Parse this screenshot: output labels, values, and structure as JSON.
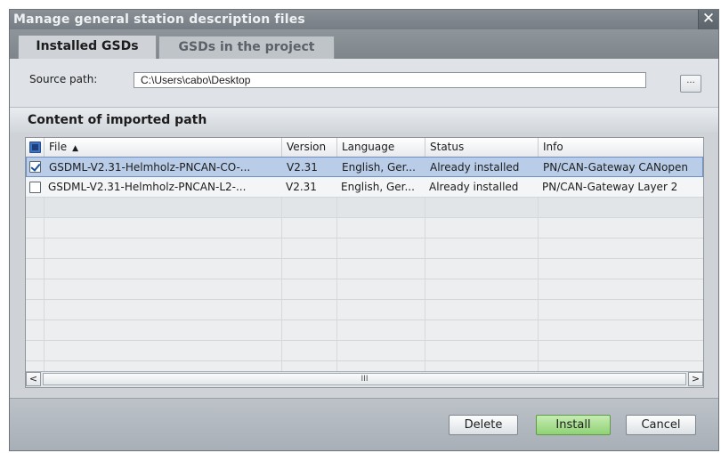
{
  "window": {
    "title": "Manage general station description files",
    "close": "✕"
  },
  "tabs": [
    {
      "label": "Installed GSDs",
      "active": true
    },
    {
      "label": "GSDs in the project",
      "active": false
    }
  ],
  "source": {
    "label": "Source path:",
    "value": "C:\\Users\\cabo\\Desktop",
    "browse": "..."
  },
  "section": {
    "title": "Content of imported path"
  },
  "table": {
    "columns": [
      {
        "label": "File",
        "sort": "▲"
      },
      {
        "label": "Version"
      },
      {
        "label": "Language"
      },
      {
        "label": "Status"
      },
      {
        "label": "Info"
      }
    ],
    "rows": [
      {
        "checked": true,
        "file": "GSDML-V2.31-Helmholz-PNCAN-CO-...",
        "version": "V2.31",
        "language": "English, Ger...",
        "status": "Already installed",
        "info": "PN/CAN-Gateway CANopen"
      },
      {
        "checked": false,
        "file": "GSDML-V2.31-Helmholz-PNCAN-L2-...",
        "version": "V2.31",
        "language": "English, Ger...",
        "status": "Already installed",
        "info": "PN/CAN-Gateway Layer 2"
      }
    ],
    "scroll": {
      "left": "<",
      "right": ">",
      "thumb": "III"
    }
  },
  "buttons": {
    "delete": "Delete",
    "install": "Install",
    "cancel": "Cancel"
  },
  "colors": {
    "install_accent": "#8fd274",
    "selection": "#b9cde8",
    "titlebar": "#7a8188"
  }
}
